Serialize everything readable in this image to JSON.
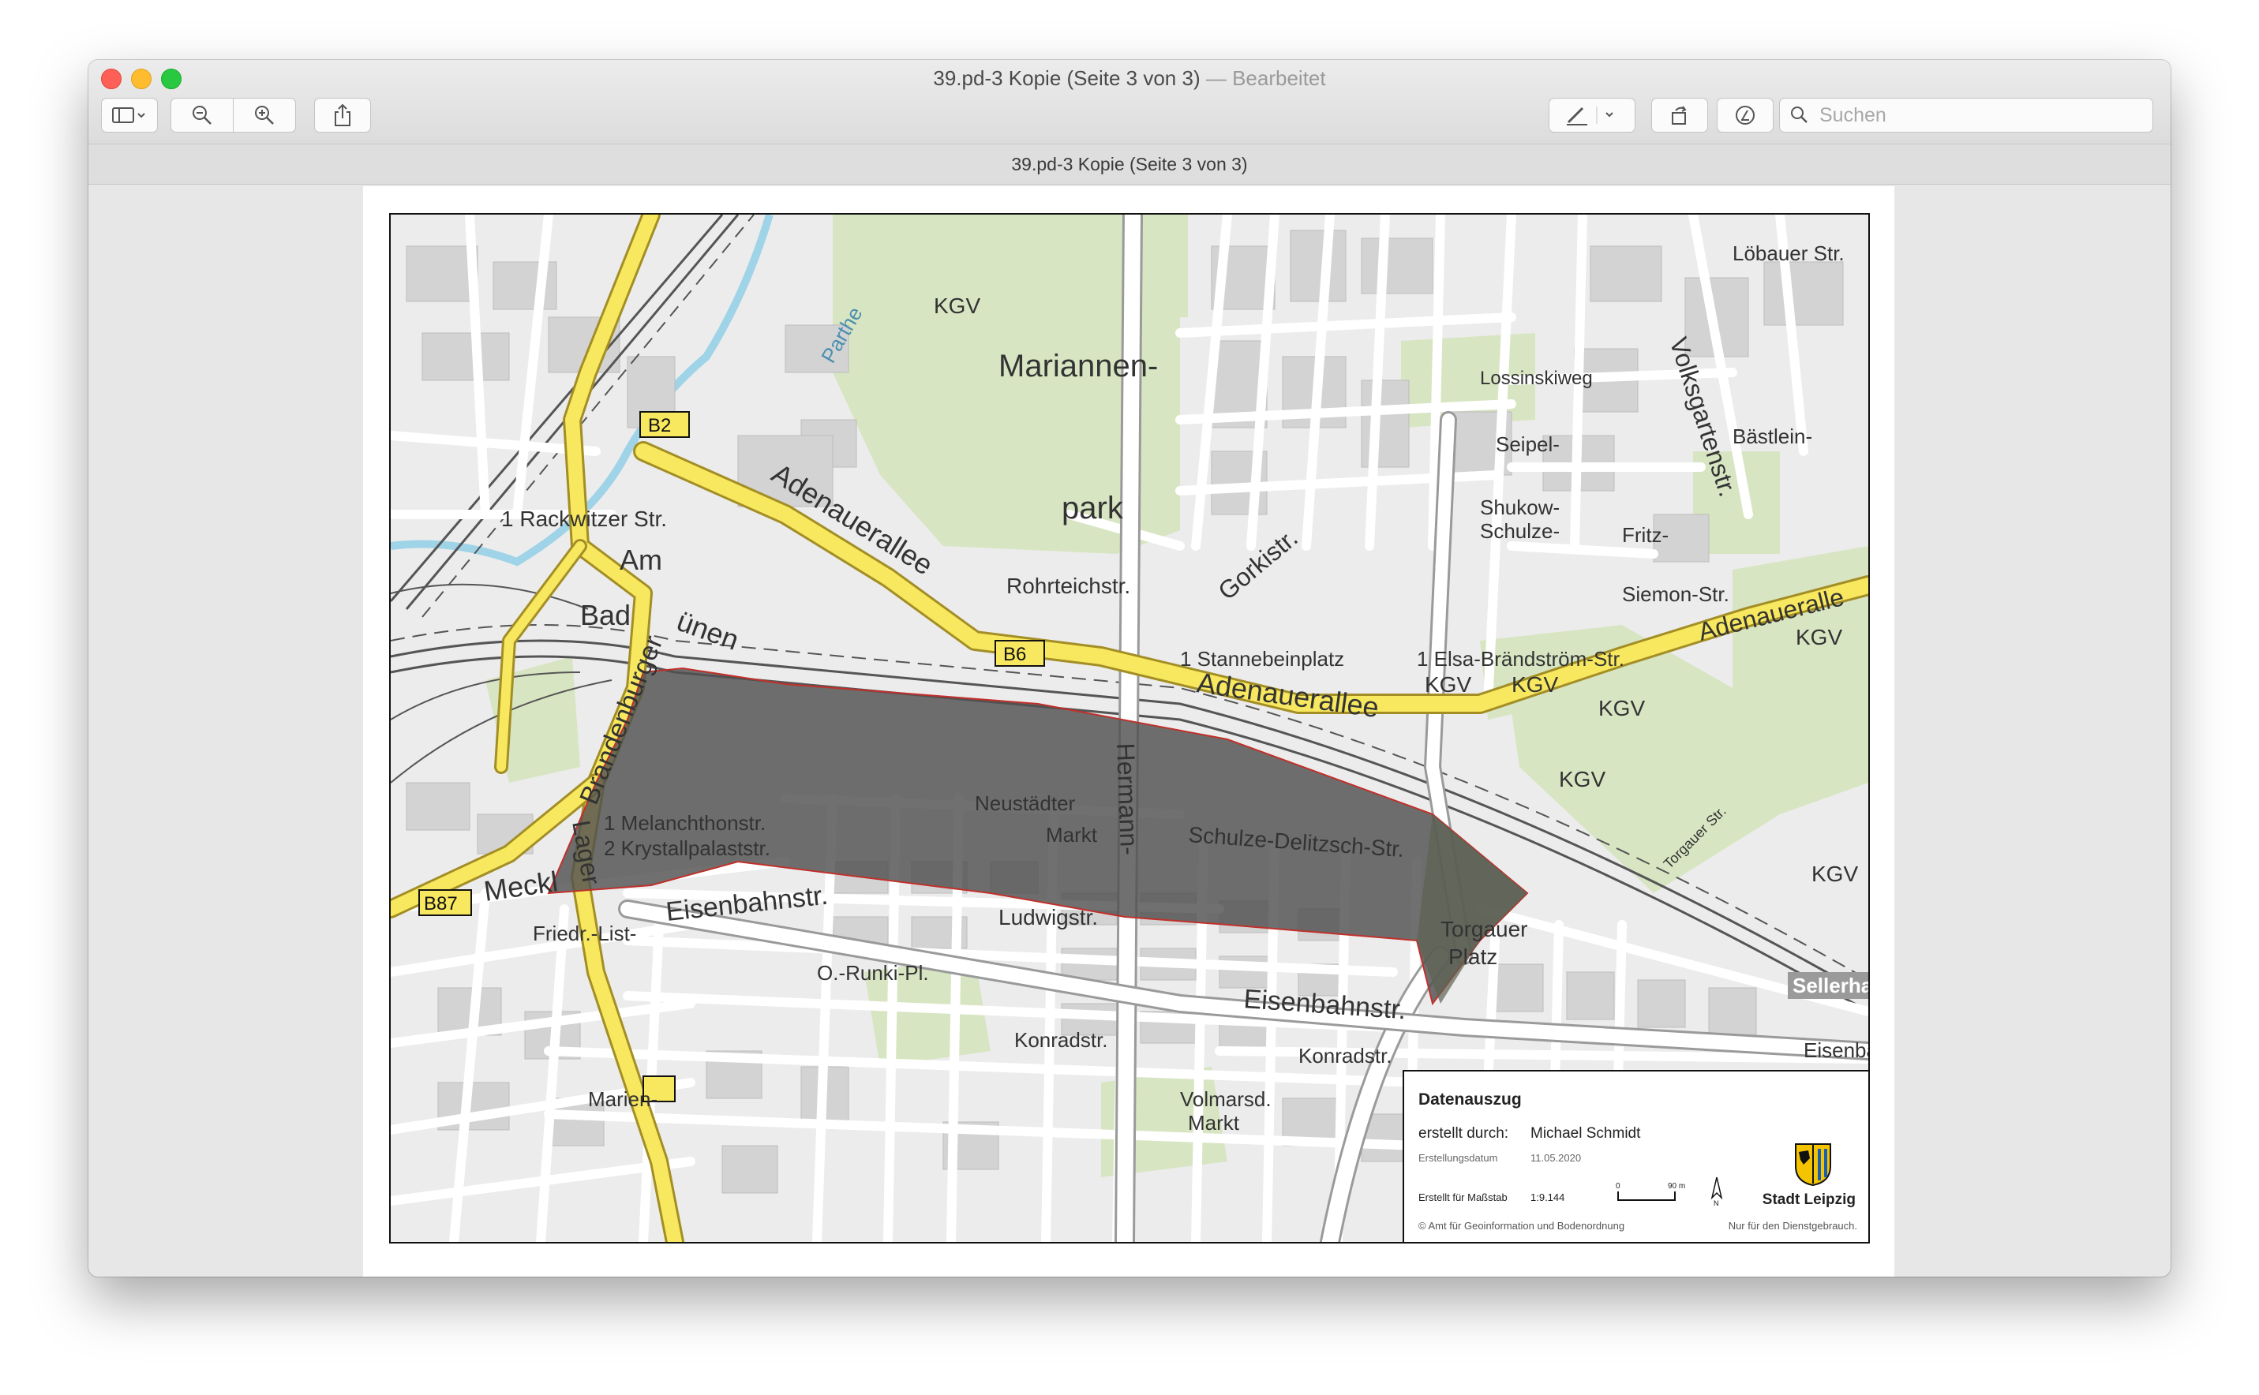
{
  "window": {
    "title": "39.pd-3 Kopie (Seite 3 von 3)",
    "title_separator": "—",
    "title_status": "Bearbeitet",
    "document_title": "39.pd-3 Kopie (Seite 3 von 3)"
  },
  "toolbar": {
    "sidebar_icon": "sidebar-icon",
    "zoom_out_icon": "zoom-out-icon",
    "zoom_in_icon": "zoom-in-icon",
    "share_icon": "share-icon",
    "markup_icon": "pen-icon",
    "rotate_icon": "rotate-icon",
    "annotate_icon": "markup-circle-icon",
    "search_placeholder": "Suchen"
  },
  "map": {
    "labels": {
      "kgv": "KGV",
      "mariannen": "Mariannen-",
      "park": "park",
      "rackwitzer_str": "1 Rackwitzer Str.",
      "am": "Am",
      "bad": "Bad",
      "bunen": "ünen",
      "b2": "B2",
      "b6": "B6",
      "b87": "B87",
      "adenauerallee": "Adenauerallee",
      "adenauerallee_east": "Adenaueralle",
      "rohrteichstr": "Rohrteichstr.",
      "stannebeinplatz": "1 Stannebeinplatz",
      "elsa_brandstroem": "1 Elsa-Brändström-Str.",
      "melanchthon": "1 Melanchthonstr.",
      "krystallpalast": "2 Krystallpalaststr.",
      "neustaedter_markt": "Neustädter",
      "markt": "Markt",
      "schulze_delitzsch": "Schulze-Delitzsch-Str.",
      "torgauer_platz": "Torgauer",
      "platz": "Platz",
      "eisenbahnstr": "Eisenbahnstr.",
      "eisenbahnstr_east": "Eisenbahnstr.",
      "ludwigstr": "Ludwigstr.",
      "konradstr": "Konradstr.",
      "o_runki": "O.-Runki-Pl.",
      "volmarsdorfer": "Volmarsd.",
      "volmarsd_markt": "Markt",
      "lossiniskiweg": "Lossinskiweg",
      "seipel": "Seipel-",
      "shukow": "Shukow-",
      "schulze_weg": "Schulze-",
      "fritz": "Fritz-",
      "siemon_str": "Siemon-Str.",
      "gorkistr": "Gorkistr.",
      "loebauer_str": "Löbauer Str.",
      "volksgartenstr": "Volksgartenstr.",
      "baslein": "Bästlein-",
      "hermann": "Hermann-",
      "lager": "Lager",
      "brandenburger": "Brandenburger",
      "meckl": "Meckl",
      "friedr_list": "Friedr.-List-",
      "sellerhausen": "Sellerha",
      "parthe": "Parthe",
      "marienplatz": "Marien-",
      "eisenb_east": "Eisenba",
      "torgauer_str": "Torgauer Str."
    }
  },
  "legend": {
    "title": "Datenauszug",
    "created_by_label": "erstellt durch:",
    "created_by": "Michael Schmidt",
    "date_label": "Erstellungsdatum",
    "date": "11.05.2020",
    "scale_label": "Erstellt für Maßstab",
    "scale": "1:9.144",
    "scale_zero": "0",
    "scale_max": "90 m",
    "north": "N",
    "copyright": "© Amt für Geoinformation und Bodenordnung",
    "note": "Nur für den Dienstgebrauch.",
    "city": "Stadt Leipzig",
    "crest_icon": "city-crest-icon"
  },
  "colors": {
    "road_major": "#f5e75a",
    "highlight_area": "#4e4e4e",
    "highlight_border": "#c0302a",
    "green_area": "#d9e6c3",
    "water": "#9fd3e8"
  }
}
